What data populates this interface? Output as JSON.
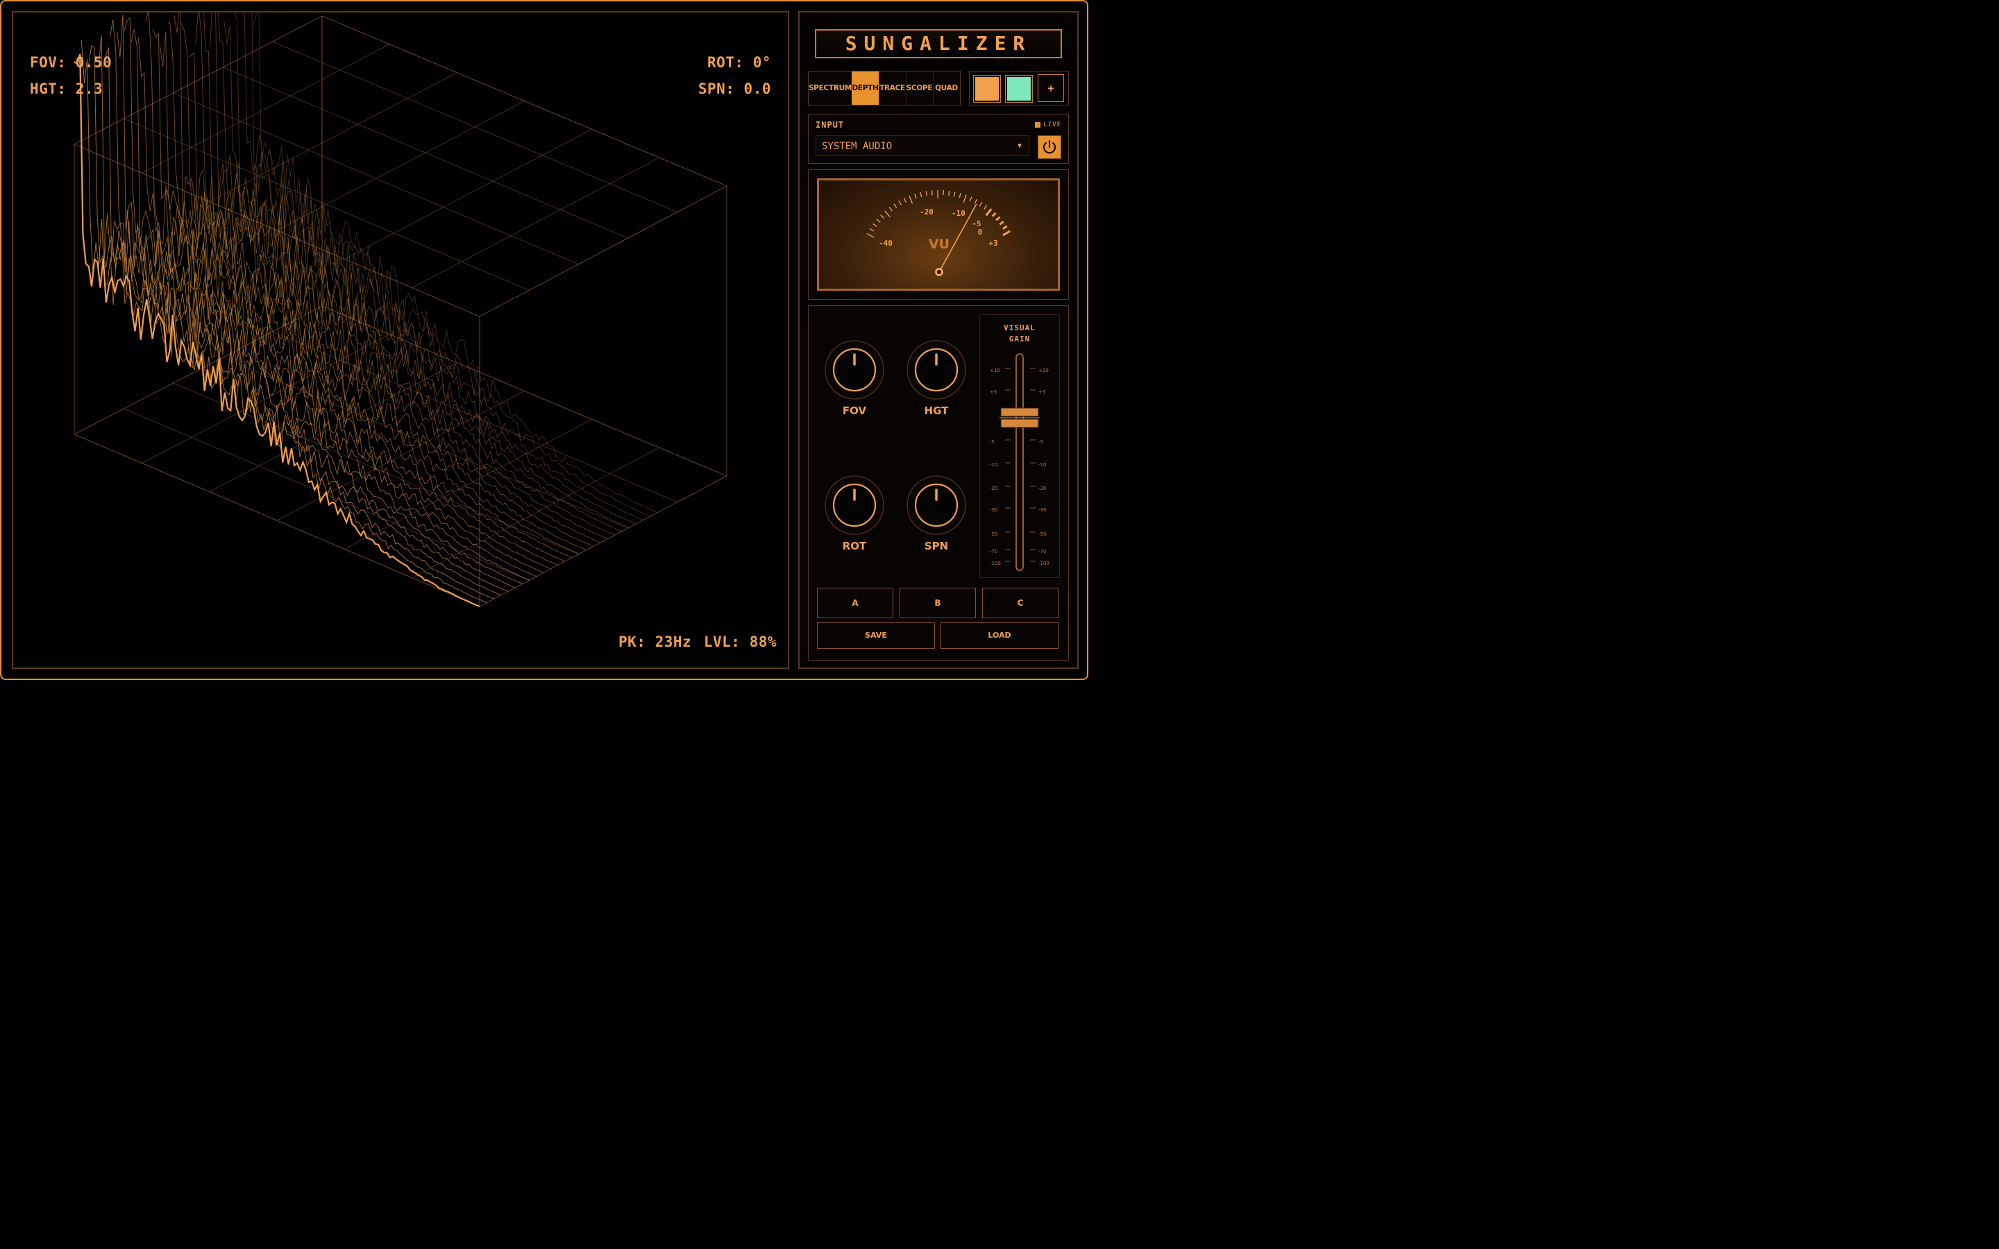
{
  "app": {
    "title": "SUNGALIZER"
  },
  "colors": {
    "accent": "#e8922e",
    "accent_text": "#f0a050",
    "border_dim": "#5a3a1a",
    "background": "#000000",
    "swatch_orange": "#f2a050",
    "swatch_mint": "#7ee8b8"
  },
  "viz": {
    "fov_readout": "FOV: 0.50",
    "hgt_readout": "HGT: 2.3",
    "rot_readout": "ROT: 0°",
    "spn_readout": "SPN: 0.0",
    "pk_readout": "PK: 23Hz",
    "lvl_readout": "LVL: 88%"
  },
  "modes": {
    "tabs": [
      "SPECTRUM",
      "DEPTH",
      "TRACE",
      "SCOPE",
      "QUAD"
    ],
    "active": "DEPTH",
    "add_label": "+"
  },
  "input": {
    "label": "INPUT",
    "live_label": "LIVE",
    "source": "SYSTEM AUDIO",
    "power_icon": "power-icon"
  },
  "vu_meter": {
    "label": "VU",
    "scale_labels": [
      "-40",
      "-20",
      "-10",
      "-5",
      "0",
      "+3"
    ],
    "needle_level_db": -8
  },
  "knobs": [
    {
      "label": "FOV",
      "value": 0.5
    },
    {
      "label": "HGT",
      "value": 0.5
    },
    {
      "label": "ROT",
      "value": 0.5
    },
    {
      "label": "SPN",
      "value": 0.5
    }
  ],
  "visual_gain": {
    "label_line1": "VISUAL",
    "label_line2": "GAIN",
    "scale": [
      "+10",
      "+5",
      "-5",
      "-10",
      "-20",
      "-30",
      "-50",
      "-70",
      "-100"
    ],
    "value_db": 0
  },
  "presets": {
    "slots": [
      "A",
      "B",
      "C"
    ],
    "save_label": "SAVE",
    "load_label": "LOAD"
  }
}
